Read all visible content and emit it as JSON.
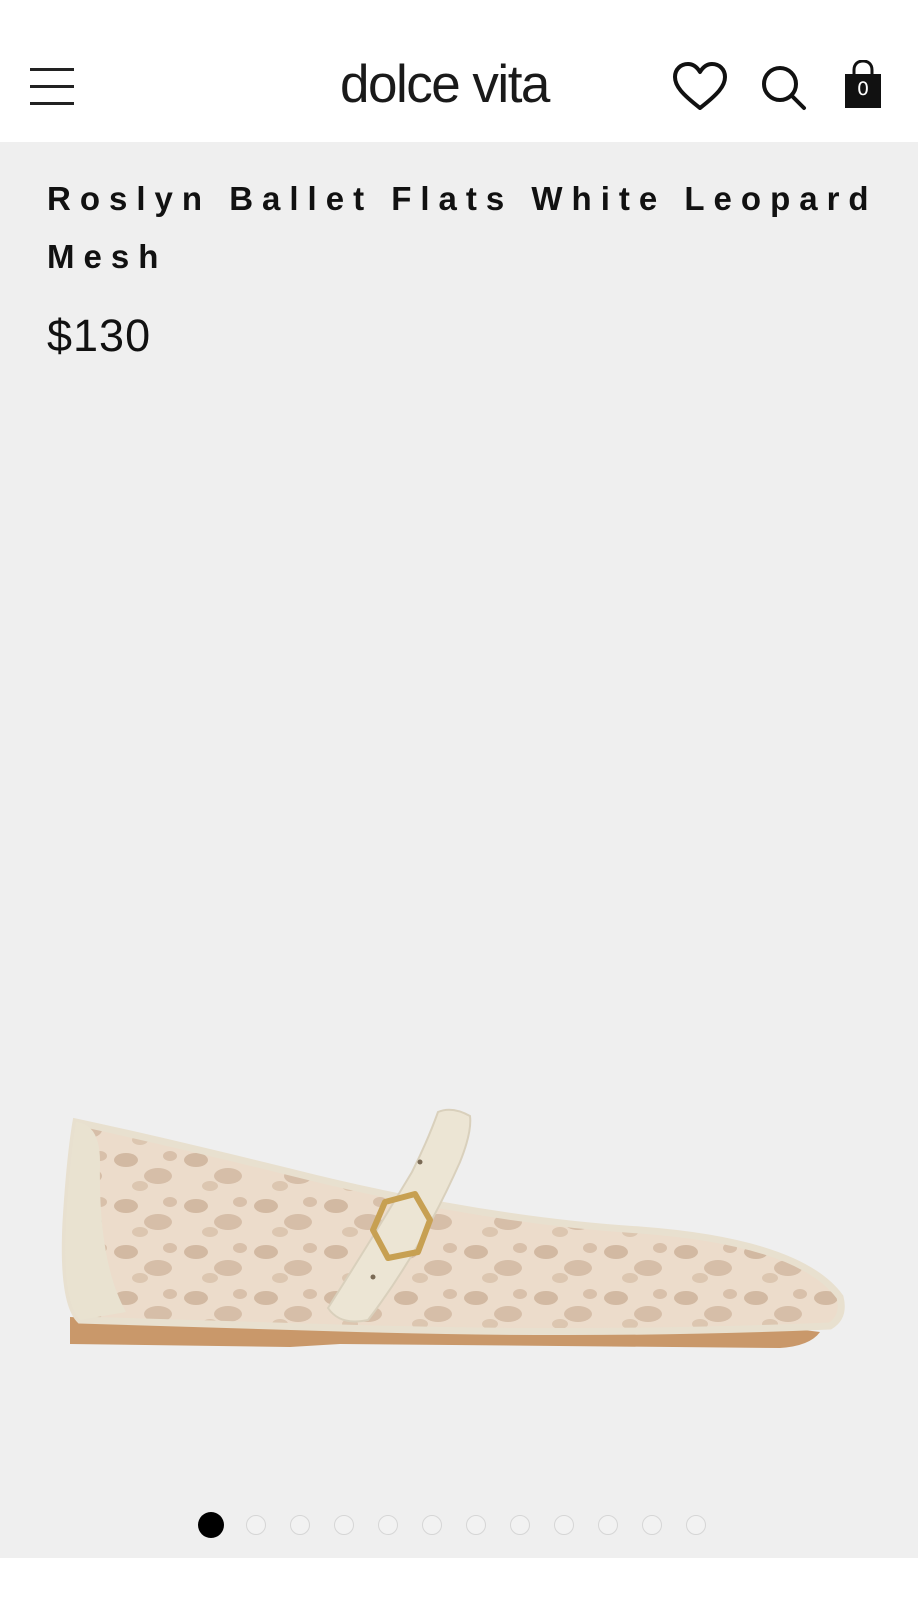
{
  "header": {
    "logo": "dolce vita",
    "cart_count": "0",
    "icons": [
      "menu-icon",
      "heart-icon",
      "search-icon",
      "shopping-bag-icon"
    ]
  },
  "product": {
    "title": "Roslyn Ballet Flats White Leopard Mesh",
    "price": "$130",
    "image": "white-leopard-mesh-ballet-flat"
  },
  "carousel": {
    "total_slides": 12,
    "active_slide": 1
  },
  "colors": {
    "background": "#ffffff",
    "product_background": "#efefef",
    "text": "#111111",
    "active_dot": "#000000"
  }
}
